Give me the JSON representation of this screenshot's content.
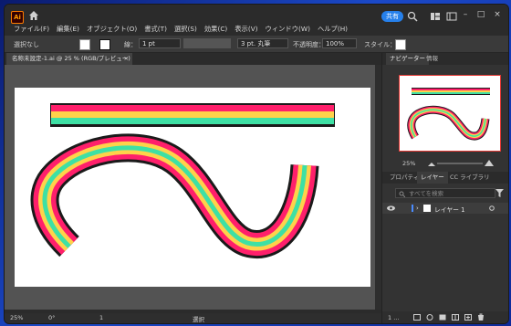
{
  "app": {
    "logo": "Ai",
    "share_label": "共有",
    "menu": [
      "ファイル(F)",
      "編集(E)",
      "オブジェクト(O)",
      "書式(T)",
      "選択(S)",
      "効果(C)",
      "表示(V)",
      "ウィンドウ(W)",
      "ヘルプ(H)"
    ]
  },
  "control_bar": {
    "selection_label": "選択なし",
    "stroke_label": "線：",
    "stroke_weight": "1 pt",
    "brush_label": "3 pt. 丸筆",
    "opacity_label": "不透明度：",
    "opacity_value": "100%",
    "style_label": "スタイル："
  },
  "document": {
    "tab_title": "名称未設定-1.ai @ 25 % (RGB/プレビュー)",
    "tab_close": "×",
    "stripe_colors": [
      "#1a1a1a",
      "#ff1f6b",
      "#ffd24a",
      "#3ee0a4"
    ]
  },
  "status": {
    "zoom": "25%",
    "rotation": "0°",
    "artboard": "1",
    "tool": "選択"
  },
  "right_panel": {
    "top_tabs": [
      "ナビゲーター",
      "情報"
    ],
    "nav_zoom": "25%",
    "mid_tabs": [
      "プロパティ",
      "レイヤー",
      "CC ライブラリ"
    ],
    "search_placeholder": "すべてを検索",
    "layer_name": "レイヤー 1",
    "layer_count": "1 ..."
  }
}
